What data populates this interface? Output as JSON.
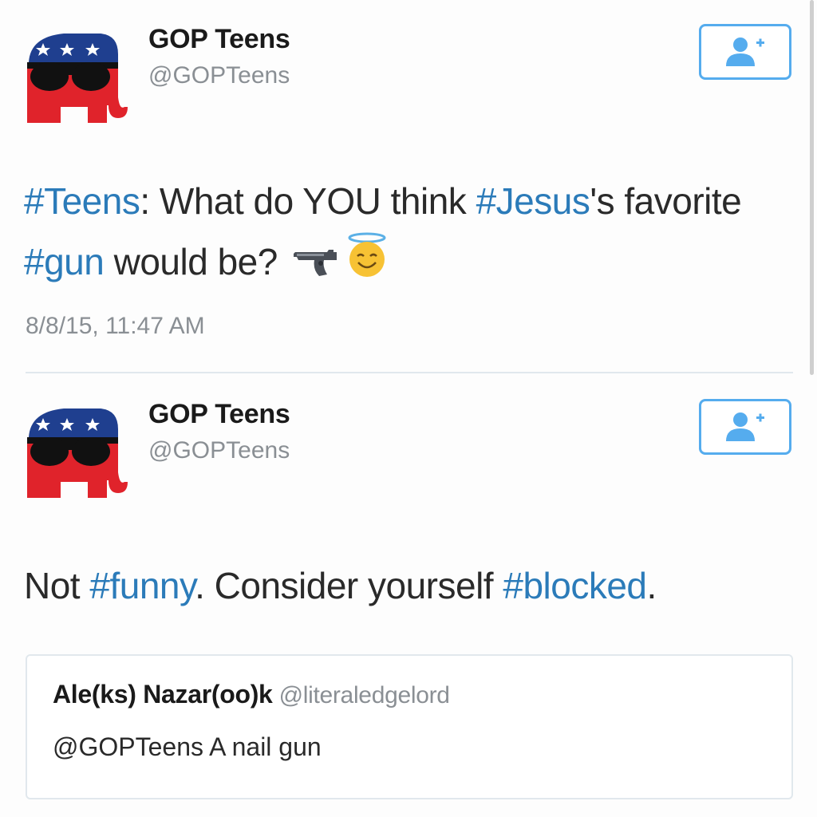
{
  "colors": {
    "hashtag": "#2b7bb9",
    "follow_border": "#55acee",
    "handle_gray": "#8a8f94",
    "logo_blue": "#1f3f8f",
    "logo_red": "#e0232b"
  },
  "tweets": [
    {
      "author": {
        "name": "GOP Teens",
        "handle": "@GOPTeens",
        "avatar_icon": "republican-elephant-sunglasses-logo"
      },
      "follow_icon": "follow-user-plus-icon",
      "text": {
        "h1": "#Teens",
        "t1": ": What do YOU think ",
        "h2": "#Jesus",
        "t2": "'s favorite ",
        "h3": "#gun",
        "t3": " would be?"
      },
      "emojis": [
        "pistol-icon",
        "smiling-face-with-halo-icon"
      ],
      "timestamp": "8/8/15, 11:47 AM"
    },
    {
      "author": {
        "name": "GOP Teens",
        "handle": "@GOPTeens",
        "avatar_icon": "republican-elephant-sunglasses-logo"
      },
      "follow_icon": "follow-user-plus-icon",
      "text": {
        "t1": "Not ",
        "h1": "#funny",
        "t2": ". Consider yourself ",
        "h2": "#blocked",
        "t3": "."
      },
      "quoted": {
        "name": "Ale(ks) Nazar(oo)k",
        "handle": "@literaledgelord",
        "text": "@GOPTeens A nail gun"
      }
    }
  ]
}
